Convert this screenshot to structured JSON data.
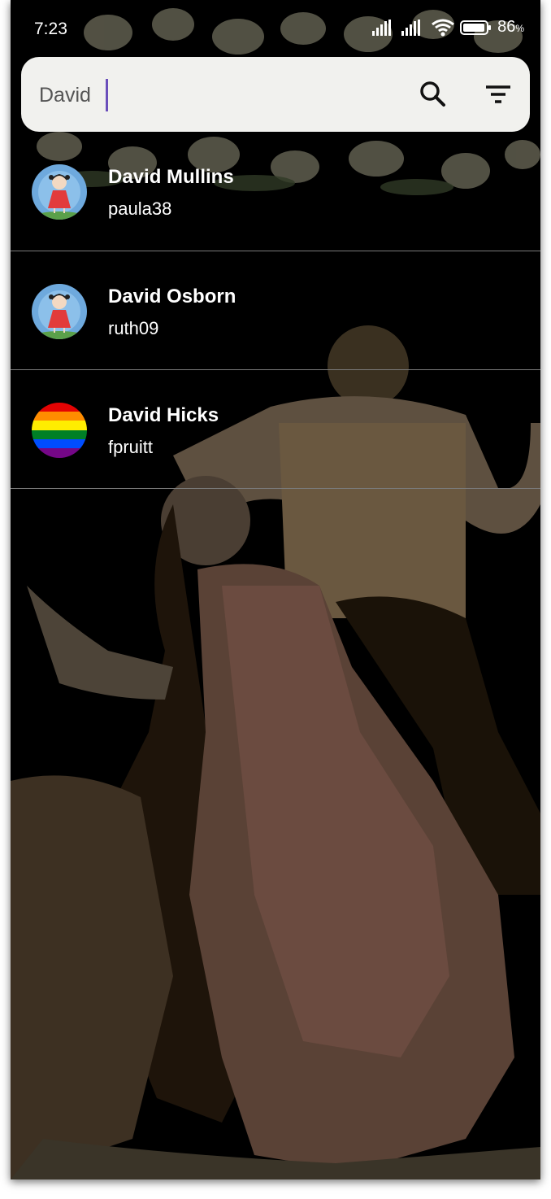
{
  "status_bar": {
    "time": "7:23",
    "battery": "86",
    "battery_unit": "%"
  },
  "search": {
    "value": "David",
    "search_icon": "search-icon",
    "filter_icon": "filter-icon"
  },
  "results": [
    {
      "name": "David Mullins",
      "username": "paula38",
      "avatar": "girl-cartoon"
    },
    {
      "name": "David Osborn",
      "username": "ruth09",
      "avatar": "girl-cartoon"
    },
    {
      "name": "David Hicks",
      "username": "fpruitt",
      "avatar": "rainbow-flag"
    }
  ],
  "colors": {
    "search_bg": "#f1f1ee",
    "caret": "#6b4fbb",
    "divider": "#7a7a7a",
    "background": "#000000"
  }
}
